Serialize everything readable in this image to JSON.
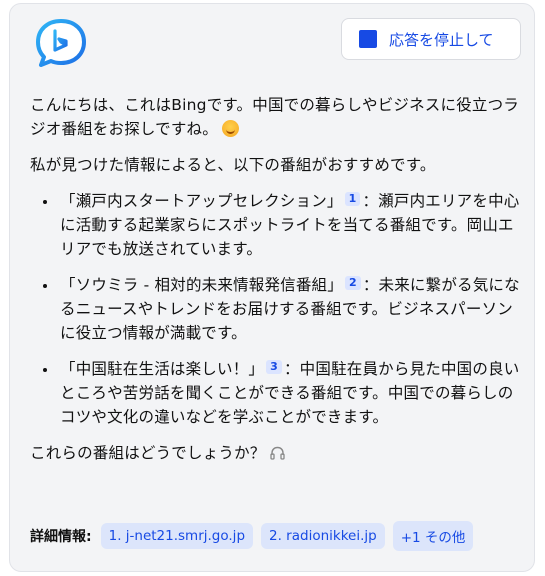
{
  "header": {
    "logo_icon": "bing-chat-logo-icon",
    "stop_button_label": "応答を停止して",
    "stop_icon": "stop-square-icon",
    "accent_color": "#174ae4"
  },
  "message": {
    "intro_line": "こんにちは、これはBingです。中国での暮らしやビジネスに役立つラジオ番組をお探しですね。",
    "intro_emoji": "smiling-face-icon",
    "lead": "私が見つけた情報によると、以下の番組がおすすめです。",
    "items": [
      {
        "title": "「瀬戸内スタートアップセレクション」",
        "cite": "1",
        "text": "：瀬戸内エリアを中心に活動する起業家らにスポットライトを当てる番組です。岡山エリアでも放送されています。"
      },
      {
        "title": "「ソウミラ - 相対的未来情報発信番組」",
        "cite": "2",
        "text": "：未来に繋がる気になるニュースやトレンドをお届けする番組です。ビジネスパーソンに役立つ情報が満載です。"
      },
      {
        "title": "「中国駐在生活は楽しい！」",
        "cite": "3",
        "text": "：中国駐在員から見た中国の良いところや苦労話を聞くことができる番組です。中国での暮らしのコツや文化の違いなどを学ぶことができます。"
      }
    ],
    "closing": "これらの番組はどうでしょうか？",
    "closing_icon": "headphones-icon"
  },
  "footer": {
    "label": "詳細情報:",
    "links": [
      "1. j-net21.smrj.go.jp",
      "2. radionikkei.jp",
      "+1 その他"
    ]
  }
}
